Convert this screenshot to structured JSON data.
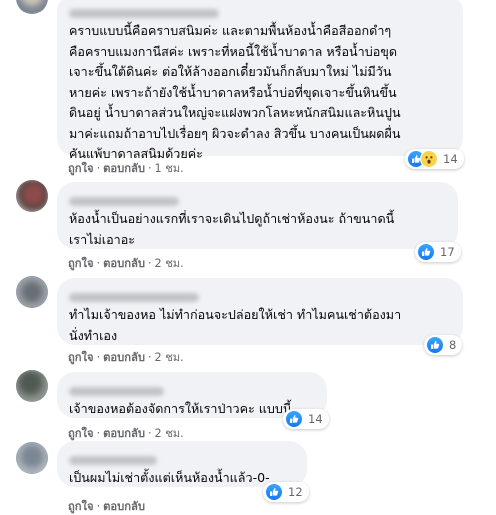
{
  "accent_color": "#1877f2",
  "reaction_icons": [
    "like-icon",
    "wow-icon"
  ],
  "comments": [
    {
      "text": "คราบแบบนี้คือคราบสนิมค่ะ และตามพื้นห้องน้ำคือสีออกดำๆ\nคือคราบแมงกานีสค่ะ เพราะที่หอนี้ใช้น้ำบาดาล หรือน้ำบ่อขุด\nเจาะขึ้นใต้ดินค่ะ ต่อให้ล้างออกเดี๋ยวมันก็กลับมาใหม่ ไม่มีวัน\nหายค่ะ เพราะถ้ายังใช้น้ำบาดาลหรือน้ำบ่อที่ขุดเจาะขึ้นหินขึ้น\nดินอยู่ น้ำบาดาลส่วนใหญ่จะแฝงพวกโลหะหนักสนิมและหินปูน\nมาค่ะแถมถ้าอาบไปเรื่อยๆ ผิวจะดำลง สิวขึ้น บางคนเป็นผดผื่น\nคันแพ้บาดาลสนิมด้วยค่ะ",
      "like": "ถูกใจ",
      "reply": "ตอบกลับ",
      "time": "1 ชม.",
      "reaction_count": "14"
    },
    {
      "text": "ห้องน้ำเป็นอย่างแรกที่เราจะเดินไปดูถ้าเช่าห้องนะ ถ้าขนาดนี้\nเราไม่เอาอะ",
      "like": "ถูกใจ",
      "reply": "ตอบกลับ",
      "time": "2 ชม.",
      "reaction_count": "17"
    },
    {
      "text": "ทำไมเจ้าของหอ ไม่ทำก่อนจะปล่อยให้เช่า ทำไมคนเช่าต้องมา\nนั่งทำเอง",
      "like": "ถูกใจ",
      "reply": "ตอบกลับ",
      "time": "2 ชม.",
      "reaction_count": "8"
    },
    {
      "text": "เจ้าของหอต้องจัดการให้เราป่าวคะ แบบนี้",
      "like": "ถูกใจ",
      "reply": "ตอบกลับ",
      "time": "2 ชม.",
      "reaction_count": "14"
    },
    {
      "text": "เป็นผมไม่เช่าตั้งแต่เห็นห้องน้ำแล้ว-0-",
      "like": "ถูกใจ",
      "reply": "ตอบกลับ",
      "time": "",
      "reaction_count": "12"
    }
  ]
}
